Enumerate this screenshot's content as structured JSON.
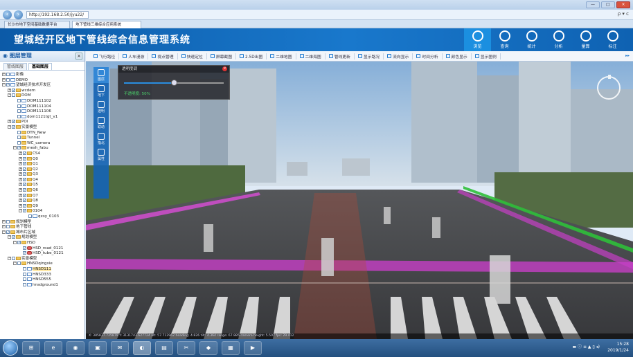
{
  "browser": {
    "url": "http://192.168.2.50/jyu22/",
    "tabs": [
      {
        "label": "长沙市地下空间基础数据平台",
        "active": false
      },
      {
        "label": "地下管线三维综合应用系统",
        "active": true
      }
    ],
    "addr_right": "ρ ▾ c",
    "window_controls": [
      "—",
      "□",
      "×"
    ]
  },
  "app": {
    "title": "望城经开区地下管线综合信息管理系统",
    "brand_color": "#1570c4",
    "nav": [
      {
        "label": "浏览",
        "icon": "globe-icon",
        "active": true
      },
      {
        "label": "查询",
        "icon": "search-shield-icon",
        "active": false
      },
      {
        "label": "统计",
        "icon": "chart-icon",
        "active": false
      },
      {
        "label": "分析",
        "icon": "analysis-icon",
        "active": false
      },
      {
        "label": "量算",
        "icon": "ruler-icon",
        "active": false
      },
      {
        "label": "标注",
        "icon": "pin-icon",
        "active": false
      }
    ]
  },
  "layers_panel": {
    "title": "图层管理",
    "close": "×",
    "tabs": [
      {
        "label": "管线图层",
        "active": false
      },
      {
        "label": "基础图层",
        "active": true
      }
    ],
    "tree": [
      {
        "label": "影像",
        "level": 0,
        "exp": "+",
        "checked": false,
        "type": "layer"
      },
      {
        "label": "DEMO",
        "level": 0,
        "exp": "+",
        "checked": false,
        "type": "layer"
      },
      {
        "label": "望城经济技术开发区",
        "level": 0,
        "exp": "−",
        "checked": true,
        "type": "layer"
      },
      {
        "label": "wcdem",
        "level": 1,
        "exp": "+",
        "checked": true,
        "type": "folder"
      },
      {
        "label": "DOM",
        "level": 1,
        "exp": "−",
        "checked": false,
        "type": "folder"
      },
      {
        "label": "DOM111102",
        "level": 2,
        "exp": "",
        "checked": false,
        "type": "layer"
      },
      {
        "label": "DOM111104",
        "level": 2,
        "exp": "",
        "checked": false,
        "type": "layer"
      },
      {
        "label": "DOM111106",
        "level": 2,
        "exp": "",
        "checked": false,
        "type": "layer"
      },
      {
        "label": "dom1121tgt_v1",
        "level": 2,
        "exp": "",
        "checked": false,
        "type": "layer"
      },
      {
        "label": "POI",
        "level": 1,
        "exp": "+",
        "checked": true,
        "type": "folder"
      },
      {
        "label": "实景模型",
        "level": 1,
        "exp": "−",
        "checked": true,
        "type": "folder"
      },
      {
        "label": "DTN_New",
        "level": 2,
        "exp": "",
        "checked": false,
        "type": "folder"
      },
      {
        "label": "Tunnel",
        "level": 2,
        "exp": "",
        "checked": false,
        "type": "folder"
      },
      {
        "label": "WC_camera",
        "level": 2,
        "exp": "",
        "checked": false,
        "type": "folder"
      },
      {
        "label": "mesh_fabu",
        "level": 2,
        "exp": "−",
        "checked": true,
        "type": "folder"
      },
      {
        "label": "CS4",
        "level": 3,
        "exp": "+",
        "checked": true,
        "type": "folder"
      },
      {
        "label": "Q0",
        "level": 3,
        "exp": "+",
        "checked": true,
        "type": "folder"
      },
      {
        "label": "Q1",
        "level": 3,
        "exp": "+",
        "checked": true,
        "type": "folder"
      },
      {
        "label": "Q2",
        "level": 3,
        "exp": "+",
        "checked": true,
        "type": "folder"
      },
      {
        "label": "Q3",
        "level": 3,
        "exp": "+",
        "checked": true,
        "type": "folder"
      },
      {
        "label": "Q4",
        "level": 3,
        "exp": "+",
        "checked": true,
        "type": "folder"
      },
      {
        "label": "Q5",
        "level": 3,
        "exp": "+",
        "checked": true,
        "type": "folder"
      },
      {
        "label": "Q6",
        "level": 3,
        "exp": "+",
        "checked": true,
        "type": "folder"
      },
      {
        "label": "Q7",
        "level": 3,
        "exp": "+",
        "checked": true,
        "type": "folder"
      },
      {
        "label": "Q8",
        "level": 3,
        "exp": "+",
        "checked": true,
        "type": "folder"
      },
      {
        "label": "Q9",
        "level": 3,
        "exp": "+",
        "checked": true,
        "type": "folder"
      },
      {
        "label": "0104",
        "level": 3,
        "exp": "−",
        "checked": true,
        "type": "folder"
      },
      {
        "label": "qxsy_0103",
        "level": 4,
        "exp": "",
        "checked": false,
        "type": "layer"
      },
      {
        "label": "规划模型",
        "level": 0,
        "exp": "+",
        "checked": false,
        "type": "folder"
      },
      {
        "label": "地下管线",
        "level": 0,
        "exp": "+",
        "checked": false,
        "type": "folder"
      },
      {
        "label": "城市片区域",
        "level": 0,
        "exp": "−",
        "checked": true,
        "type": "folder"
      },
      {
        "label": "规划模型",
        "level": 1,
        "exp": "−",
        "checked": true,
        "type": "folder"
      },
      {
        "label": "HSD",
        "level": 2,
        "exp": "−",
        "checked": true,
        "type": "folder"
      },
      {
        "label": "HSD_road_0121",
        "level": 3,
        "exp": "",
        "checked": true,
        "type": "tube"
      },
      {
        "label": "HSD_tube_0121",
        "level": 3,
        "exp": "",
        "checked": true,
        "type": "tube"
      },
      {
        "label": "实景模型",
        "level": 1,
        "exp": "−",
        "checked": false,
        "type": "folder"
      },
      {
        "label": "HNSDqingxie",
        "level": 2,
        "exp": "−",
        "checked": false,
        "type": "folder"
      },
      {
        "label": "HNSD111",
        "level": 3,
        "exp": "",
        "checked": false,
        "type": "layer",
        "selected": true
      },
      {
        "label": "HNSD333",
        "level": 3,
        "exp": "",
        "checked": false,
        "type": "layer"
      },
      {
        "label": "HNSD555",
        "level": 3,
        "exp": "",
        "checked": false,
        "type": "layer"
      },
      {
        "label": "hnsdground1",
        "level": 3,
        "exp": "",
        "checked": false,
        "type": "layer"
      }
    ]
  },
  "toolbar": [
    {
      "label": "飞行路径"
    },
    {
      "label": "人车漫游"
    },
    {
      "label": "视点管理"
    },
    {
      "label": "快速定位"
    },
    {
      "label": "屏幕截图"
    },
    {
      "label": "2.5D出图"
    },
    {
      "label": "二维地图"
    },
    {
      "label": "二维海图"
    },
    {
      "label": "管线更新"
    },
    {
      "label": "显示路况"
    },
    {
      "label": "流向显示"
    },
    {
      "label": "时间分析"
    },
    {
      "label": "颜色显示"
    },
    {
      "label": "显示图例"
    }
  ],
  "toolbar_more": "▸▸",
  "side_tools": [
    {
      "label": "图层",
      "active": true
    },
    {
      "label": "地下",
      "active": false
    },
    {
      "label": "透明",
      "active": false
    },
    {
      "label": "联动",
      "active": false
    },
    {
      "label": "指北",
      "active": false
    },
    {
      "label": "属性",
      "active": false
    }
  ],
  "opacity_dialog": {
    "title": "透明度调",
    "value_label": "不透明度: 50%",
    "value": 0.5
  },
  "status_line": "X: 385837.725879   Y: 3131743.627724   alt: 57.712962   heading: 4.826   tilt: 4.364   range: 67.885   camera height: 5.507   fps: 29.412",
  "taskbar": {
    "apps": [
      "⊞",
      "e",
      "◉",
      "▣",
      "✉",
      "◐",
      "▤",
      "✂",
      "◆",
      "▦",
      "▶"
    ],
    "clock_time": "15:28",
    "clock_date": "2019/1/24",
    "tray_icons": "▬ ⓘ ≡ ▲ ▯ ◂)"
  }
}
